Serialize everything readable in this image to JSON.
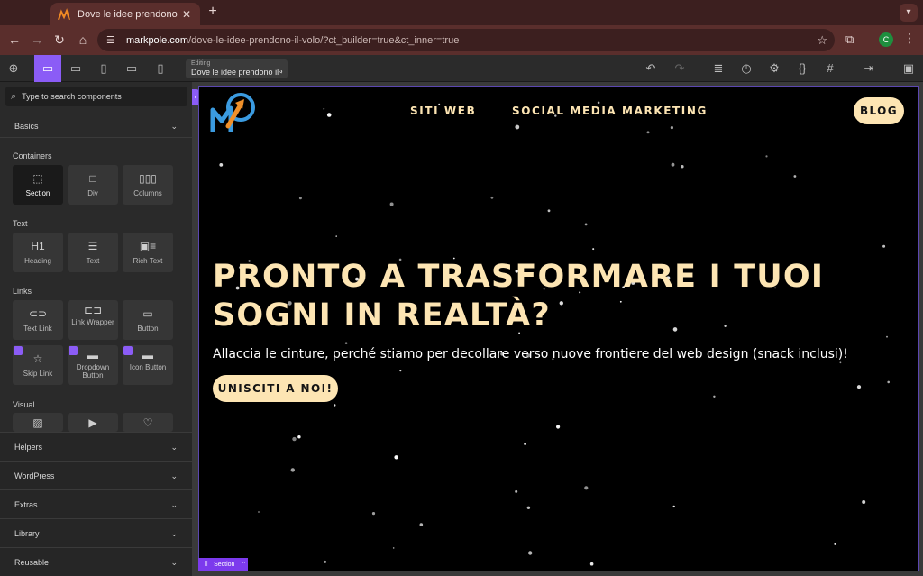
{
  "browser": {
    "tab_title": "Dove le idee prendono il volo",
    "url_host": "markpole.com",
    "url_rest": "/dove-le-idee-prendono-il-volo/?ct_builder=true&ct_inner=true",
    "profile_initial": "C"
  },
  "toolbar": {
    "editing_label": "Editing",
    "editing_page": "Dove le idee prendono il volo"
  },
  "sidebar": {
    "search_placeholder": "Type to search components",
    "basics": "Basics",
    "categories": {
      "containers": "Containers",
      "text": "Text",
      "links": "Links",
      "visual": "Visual"
    },
    "tiles": {
      "section": "Section",
      "div": "Div",
      "columns": "Columns",
      "heading_icon": "H1",
      "heading": "Heading",
      "text": "Text",
      "rich_text": "Rich Text",
      "text_link": "Text Link",
      "link_wrapper": "Link Wrapper",
      "button": "Button",
      "skip_link": "Skip Link",
      "dropdown_button": "Dropdown Button",
      "icon_button": "Icon Button"
    },
    "lower_sections": [
      "Helpers",
      "WordPress",
      "Extras",
      "Library",
      "Reusable"
    ]
  },
  "site": {
    "nav": [
      "SITI WEB",
      "SOCIAL MEDIA MARKETING"
    ],
    "blog": "BLOG",
    "hero_title": "PRONTO A TRASFORMARE I TUOI SOGNI IN REALTÀ?",
    "hero_subtitle": "Allaccia le cinture, perché stiamo per decollare verso nuove frontiere del web design (snack inclusi)!",
    "cta": "UNISCITI A NOI!"
  },
  "selection_tag": "Section",
  "colors": {
    "accent": "#8b5cf6",
    "cream": "#fde5b3",
    "chrome_bg": "#5a2e2c"
  }
}
